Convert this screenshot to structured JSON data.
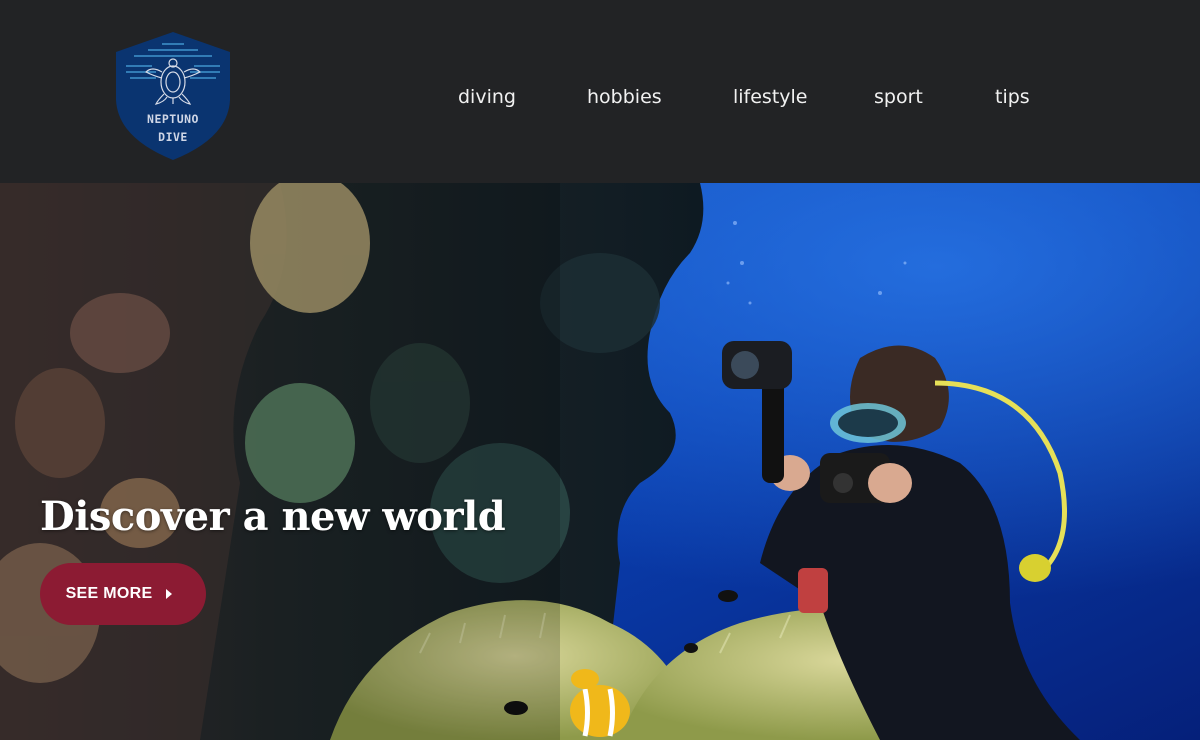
{
  "brand": {
    "line1": "NEPTUNO",
    "line2": "DIVE",
    "shield_color": "#0a3470",
    "icon": "sea-turtle-icon"
  },
  "nav": {
    "items": [
      {
        "label": "diving"
      },
      {
        "label": "hobbies"
      },
      {
        "label": "lifestyle"
      },
      {
        "label": "sport"
      },
      {
        "label": "tips"
      }
    ]
  },
  "hero": {
    "title": "Discover a new world",
    "button_label": "SEE MORE",
    "button_icon": "chevron-right-icon",
    "button_color": "#8c1b33",
    "image": "underwater-diver-with-camera-photo"
  },
  "colors": {
    "header_bg": "#222325",
    "nav_text": "#f1f1f1",
    "ocean_blue": "#0a3fb0"
  }
}
